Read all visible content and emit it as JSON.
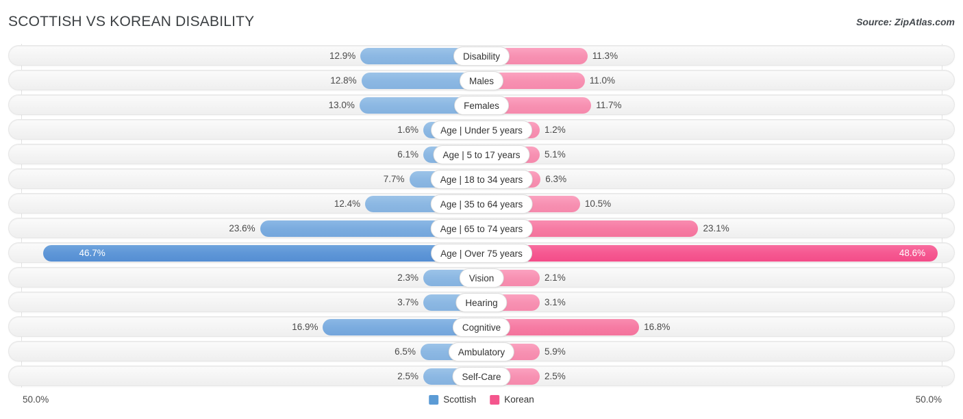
{
  "header": {
    "title": "SCOTTISH VS KOREAN DISABILITY",
    "source": "Source: ZipAtlas.com"
  },
  "axis": {
    "left_label": "50.0%",
    "right_label": "50.0%",
    "max": 50.0
  },
  "legend": {
    "items": [
      {
        "label": "Scottish",
        "color": "#5b9bd5"
      },
      {
        "label": "Korean",
        "color": "#f4568d"
      }
    ]
  },
  "chart_data": {
    "type": "bar",
    "orientation": "horizontal-diverging",
    "title": "SCOTTISH VS KOREAN DISABILITY",
    "xlabel": "",
    "ylabel": "",
    "xlim": [
      -50.0,
      50.0
    ],
    "grid": true,
    "legend_position": "bottom-center",
    "unit": "%",
    "categories": [
      "Disability",
      "Males",
      "Females",
      "Age | Under 5 years",
      "Age | 5 to 17 years",
      "Age | 18 to 34 years",
      "Age | 35 to 64 years",
      "Age | 65 to 74 years",
      "Age | Over 75 years",
      "Vision",
      "Hearing",
      "Cognitive",
      "Ambulatory",
      "Self-Care"
    ],
    "series": [
      {
        "name": "Scottish",
        "color": "#5b9bd5",
        "side": "left",
        "values": [
          12.9,
          12.8,
          13.0,
          1.6,
          6.1,
          7.7,
          12.4,
          23.6,
          46.7,
          2.3,
          3.7,
          16.9,
          6.5,
          2.5
        ],
        "labels": [
          "12.9%",
          "12.8%",
          "13.0%",
          "1.6%",
          "6.1%",
          "7.7%",
          "12.4%",
          "23.6%",
          "46.7%",
          "2.3%",
          "3.7%",
          "16.9%",
          "6.5%",
          "2.5%"
        ]
      },
      {
        "name": "Korean",
        "color": "#f4568d",
        "side": "right",
        "values": [
          11.3,
          11.0,
          11.7,
          1.2,
          5.1,
          6.3,
          10.5,
          23.1,
          48.6,
          2.1,
          3.1,
          16.8,
          5.9,
          2.5
        ],
        "labels": [
          "11.3%",
          "11.0%",
          "11.7%",
          "1.2%",
          "5.1%",
          "6.3%",
          "10.5%",
          "23.1%",
          "48.6%",
          "2.1%",
          "3.1%",
          "16.8%",
          "5.9%",
          "2.5%"
        ]
      }
    ]
  }
}
